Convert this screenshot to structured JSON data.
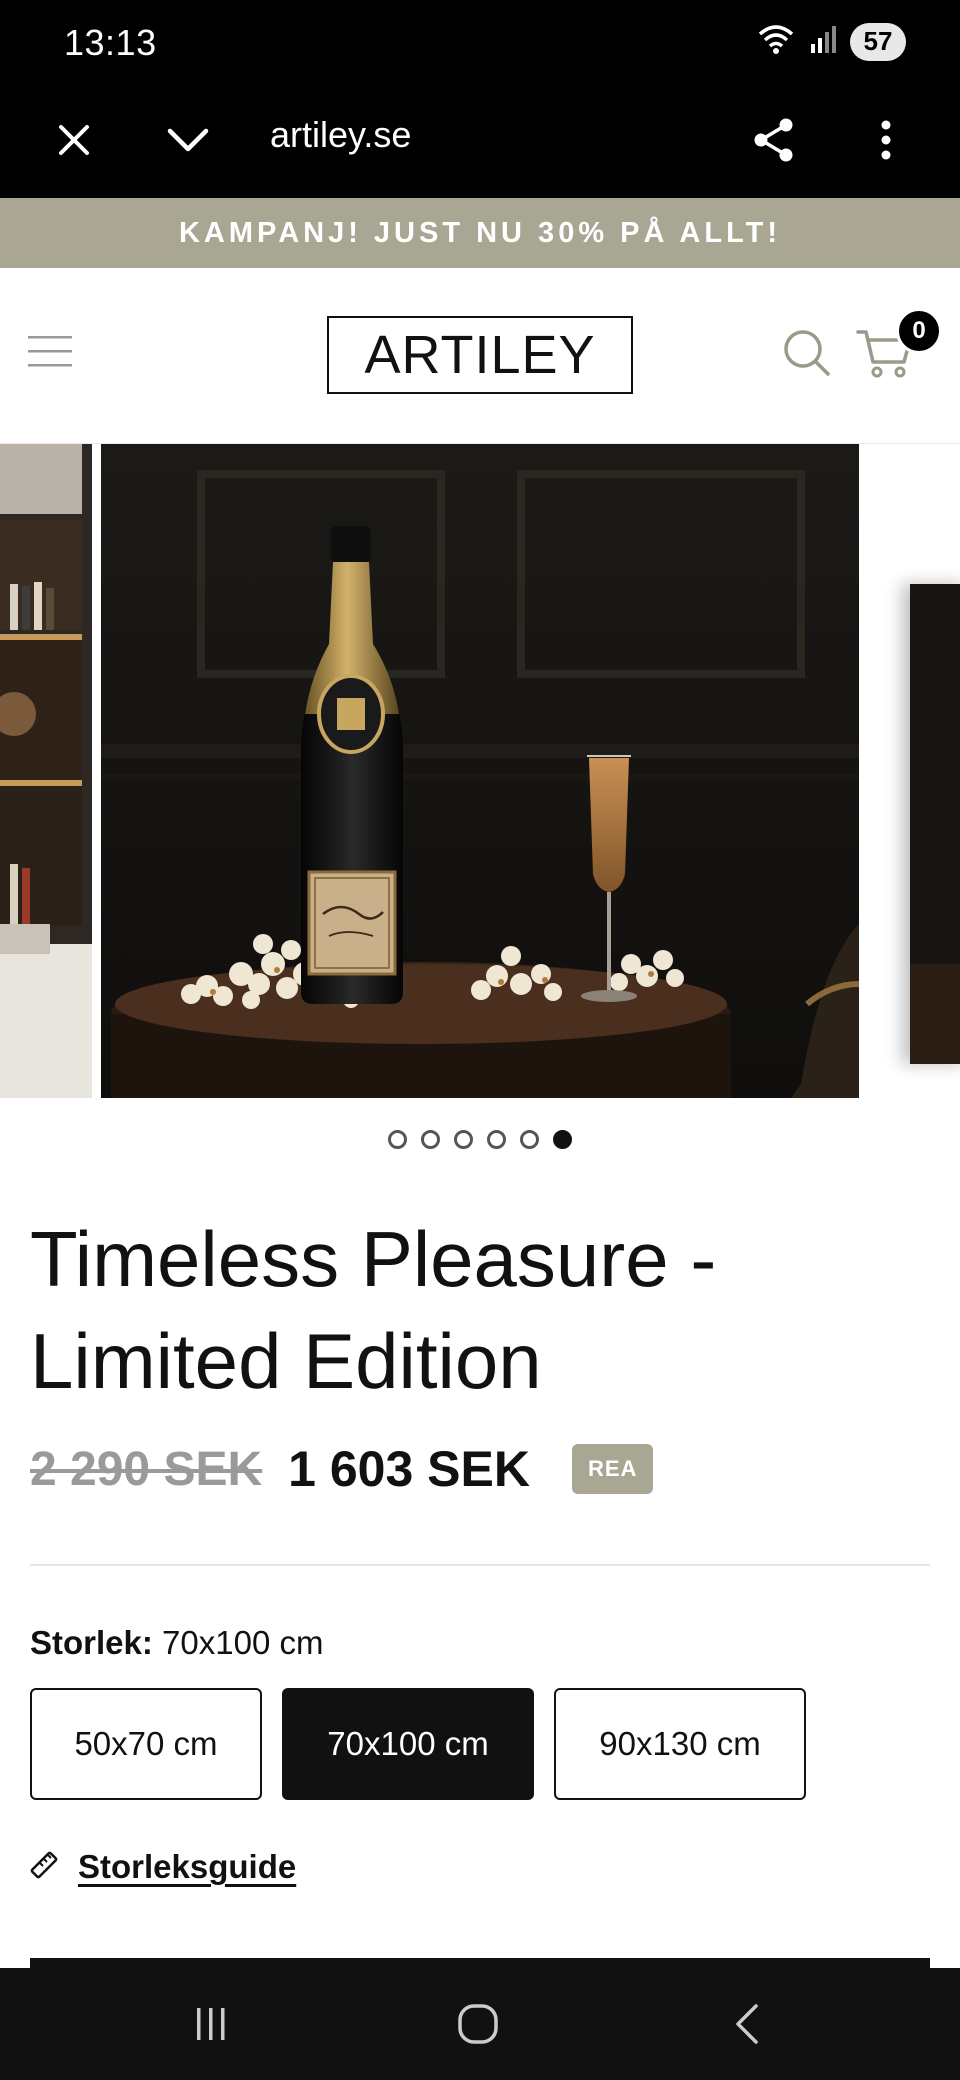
{
  "status_bar": {
    "time": "13:13",
    "battery": "57",
    "icons": [
      "wifi-icon",
      "signal-icon"
    ]
  },
  "browser": {
    "url": "artiley.se",
    "icons": [
      "close-icon",
      "chevron-down-icon",
      "share-icon",
      "more-vert-icon"
    ]
  },
  "promo": {
    "text": "KAMPANJ! JUST NU 30% PÅ ALLT!",
    "color": "#a9a693"
  },
  "header": {
    "logo": "ARTILEY",
    "cart_count": "0",
    "icons": [
      "menu-icon",
      "search-icon",
      "cart-icon"
    ]
  },
  "gallery": {
    "slide_count": 6,
    "active_index": 5
  },
  "product": {
    "title": "Timeless Pleasure - Limited Edition",
    "old_price": "2 290 SEK",
    "new_price": "1 603 SEK",
    "badge": "REA",
    "size_label": "Storlek:",
    "size_selected": "70x100 cm",
    "sizes": [
      "50x70 cm",
      "70x100 cm",
      "90x130 cm"
    ],
    "size_guide": "Storleksguide"
  },
  "colors": {
    "accent": "#a9a693",
    "dark": "#111111"
  }
}
